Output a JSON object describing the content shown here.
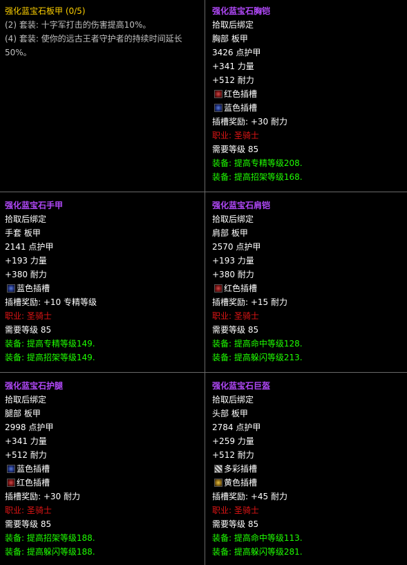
{
  "set_panel": {
    "title": "强化蓝宝石板甲 (0/5)",
    "bonuses": [
      "(2) 套装: 十字军打击的伤害提高10%。",
      "(4) 套装: 使你的远古王者守护者的持续时间延长",
      "50%。"
    ]
  },
  "items": [
    {
      "name": "强化蓝宝石胸铠",
      "bind": "拾取后绑定",
      "slot_type": "胸部 板甲",
      "armor": "3426 点护甲",
      "stats": [
        "+341 力量",
        "+512 耐力"
      ],
      "sockets": [
        {
          "icon": "red-socket-icon",
          "label": "红色插槽"
        },
        {
          "icon": "blue-socket-icon",
          "label": "蓝色插槽"
        }
      ],
      "socket_bonus": "插槽奖励: +30 耐力",
      "class_req": "职业: 圣骑士",
      "level_req": "需要等级 85",
      "equip": [
        "装备: 提高专精等级208.",
        "装备: 提高招架等级168."
      ]
    },
    {
      "name": "强化蓝宝石手甲",
      "bind": "拾取后绑定",
      "slot_type": "手套 板甲",
      "armor": "2141 点护甲",
      "stats": [
        "+193 力量",
        "+380 耐力"
      ],
      "sockets": [
        {
          "icon": "blue-socket-icon",
          "label": "蓝色插槽"
        }
      ],
      "socket_bonus": "插槽奖励: +10 专精等级",
      "class_req": "职业: 圣骑士",
      "level_req": "需要等级 85",
      "equip": [
        "装备: 提高专精等级149.",
        "装备: 提高招架等级149."
      ]
    },
    {
      "name": "强化蓝宝石肩铠",
      "bind": "拾取后绑定",
      "slot_type": "肩部 板甲",
      "armor": "2570 点护甲",
      "stats": [
        "+193 力量",
        "+380 耐力"
      ],
      "sockets": [
        {
          "icon": "red-socket-icon",
          "label": "红色插槽"
        }
      ],
      "socket_bonus": "插槽奖励: +15 耐力",
      "class_req": "职业: 圣骑士",
      "level_req": "需要等级 85",
      "equip": [
        "装备: 提高命中等级128.",
        "装备: 提高躲闪等级213."
      ]
    },
    {
      "name": "强化蓝宝石护腿",
      "bind": "拾取后绑定",
      "slot_type": "腿部 板甲",
      "armor": "2998 点护甲",
      "stats": [
        "+341 力量",
        "+512 耐力"
      ],
      "sockets": [
        {
          "icon": "blue-socket-icon",
          "label": "蓝色插槽"
        },
        {
          "icon": "red-socket-icon",
          "label": "红色插槽"
        }
      ],
      "socket_bonus": "插槽奖励: +30 耐力",
      "class_req": "职业: 圣骑士",
      "level_req": "需要等级 85",
      "equip": [
        "装备: 提高招架等级188.",
        "装备: 提高躲闪等级188."
      ]
    },
    {
      "name": "强化蓝宝石巨盔",
      "bind": "拾取后绑定",
      "slot_type": "头部 板甲",
      "armor": "2784 点护甲",
      "stats": [
        "+259 力量",
        "+512 耐力"
      ],
      "sockets": [
        {
          "icon": "prismatic-socket-icon",
          "label": "多彩插槽"
        },
        {
          "icon": "yellow-socket-icon",
          "label": "黄色插槽"
        }
      ],
      "socket_bonus": "插槽奖励: +45 耐力",
      "class_req": "职业: 圣骑士",
      "level_req": "需要等级 85",
      "equip": [
        "装备: 提高命中等级113.",
        "装备: 提高躲闪等级281."
      ]
    }
  ],
  "colors": {
    "item_name": "#b048f8",
    "set_title": "#ffd100",
    "class_req": "#e01515",
    "equip": "#1eff00",
    "divider": "#6a6a6a"
  }
}
